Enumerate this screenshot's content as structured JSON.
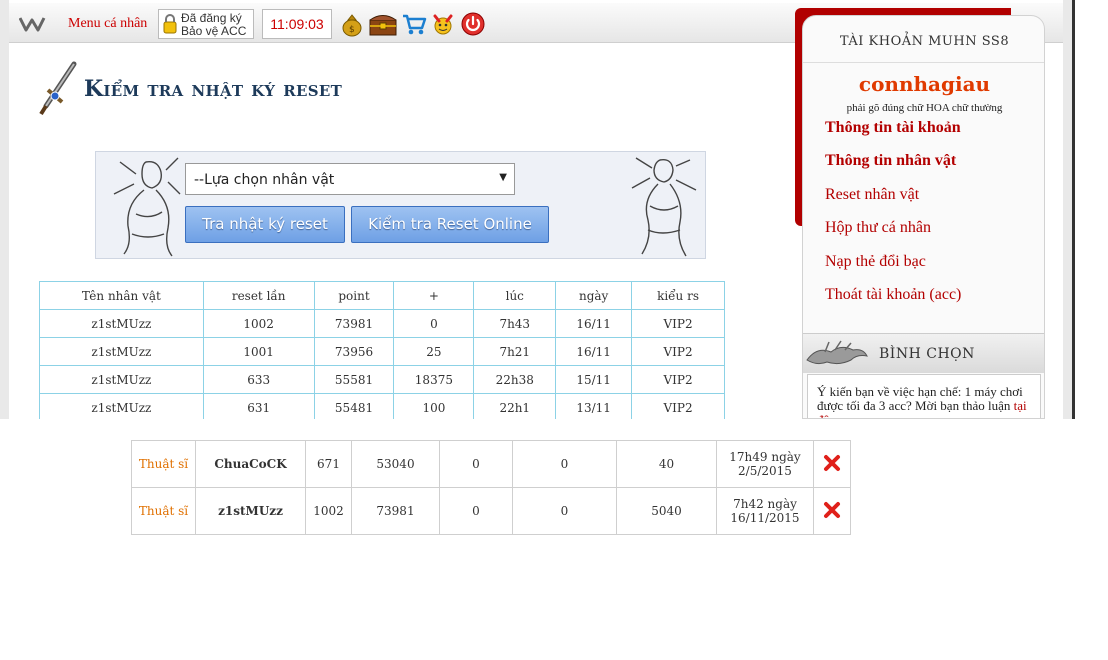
{
  "toolbar": {
    "menu_label": "Menu cá nhân",
    "account_line1": "Đã đăng ký",
    "account_line2": "Bảo vệ ACC",
    "clock": "11:09:03",
    "icons": [
      "money-bag-icon",
      "treasure-chest-icon",
      "shopping-cart-icon",
      "lucky-charm-icon",
      "power-icon"
    ]
  },
  "page": {
    "title": "Kiểm tra nhật ký reset"
  },
  "filter": {
    "select_value": "--Lựa chọn nhân vật",
    "btn_log": "Tra nhật ký reset",
    "btn_online": "Kiểm tra Reset Online"
  },
  "reset_log": {
    "headers": [
      "Tên nhân vật",
      "reset lần",
      "point",
      "+",
      "lúc",
      "ngày",
      "kiểu rs"
    ],
    "rows": [
      [
        "z1stMUzz",
        "1002",
        "73981",
        "0",
        "7h43",
        "16/11",
        "VIP2"
      ],
      [
        "z1stMUzz",
        "1001",
        "73956",
        "25",
        "7h21",
        "16/11",
        "VIP2"
      ],
      [
        "z1stMUzz",
        "633",
        "55581",
        "18375",
        "22h38",
        "15/11",
        "VIP2"
      ],
      [
        "z1stMUzz",
        "631",
        "55481",
        "100",
        "22h1",
        "13/11",
        "VIP2"
      ]
    ]
  },
  "sidebar": {
    "account_heading": "TÀI KHOẢN MUHN SS8",
    "username": "connhagiau",
    "case_note": "phải gõ đúng chữ HOA chữ thường",
    "menu": [
      "Thông tin tài khoản",
      "Thông tin nhân vật",
      "Reset nhân vật",
      "Hộp thư cá nhân",
      "Nạp thẻ đổi bạc",
      "Thoát tài khoản (acc)"
    ],
    "vote_heading": "BÌNH CHỌN",
    "vote_text": "Ý kiến bạn về việc hạn chế: 1 máy chơi được tối đa 3 acc? Mời bạn thảo luận",
    "vote_text_cut": "tại đây"
  },
  "reset_online": {
    "rows": [
      {
        "class": "Thuật sĩ",
        "name": "ChuaCoCK",
        "reset": "671",
        "point": "53040",
        "c5": "0",
        "c6": "0",
        "c7": "40",
        "time": "17h49 ngày",
        "date": "2/5/2015"
      },
      {
        "class": "Thuật sĩ",
        "name": "z1stMUzz",
        "reset": "1002",
        "point": "73981",
        "c5": "0",
        "c6": "0",
        "c7": "5040",
        "time": "7h42 ngày",
        "date": "16/11/2015"
      }
    ]
  },
  "colors": {
    "accent_red": "#b30000",
    "button_blue": "#7aa9e8",
    "table_border": "#8cd2e6"
  }
}
